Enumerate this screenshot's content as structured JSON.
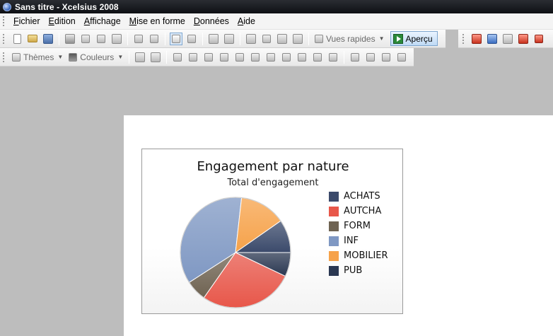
{
  "window": {
    "title": "Sans titre - Xcelsius 2008"
  },
  "menu": [
    {
      "label": "Fichier"
    },
    {
      "label": "Edition"
    },
    {
      "label": "Affichage"
    },
    {
      "label": "Mise en forme"
    },
    {
      "label": "Données"
    },
    {
      "label": "Aide"
    }
  ],
  "toolbar": {
    "quick_views_label": "Vues rapides",
    "preview_label": "Aperçu",
    "themes_label": "Thèmes",
    "colors_label": "Couleurs"
  },
  "chart_data": {
    "type": "pie",
    "title": "Engagement par nature",
    "subtitle": "Total d'engagement",
    "legend_position": "right",
    "categories": [
      "ACHATS",
      "AUTCHA",
      "FORM",
      "INF",
      "MOBILIER",
      "PUB"
    ],
    "values": [
      16.5,
      47,
      10.5,
      61,
      23,
      12
    ],
    "colors": [
      "#3b4a6b",
      "#e8574a",
      "#6f6352",
      "#7f98c3",
      "#f6a24a",
      "#2b3852"
    ],
    "slice_order": [
      "PUB",
      "AUTCHA",
      "FORM",
      "INF",
      "MOBILIER",
      "ACHATS"
    ]
  }
}
